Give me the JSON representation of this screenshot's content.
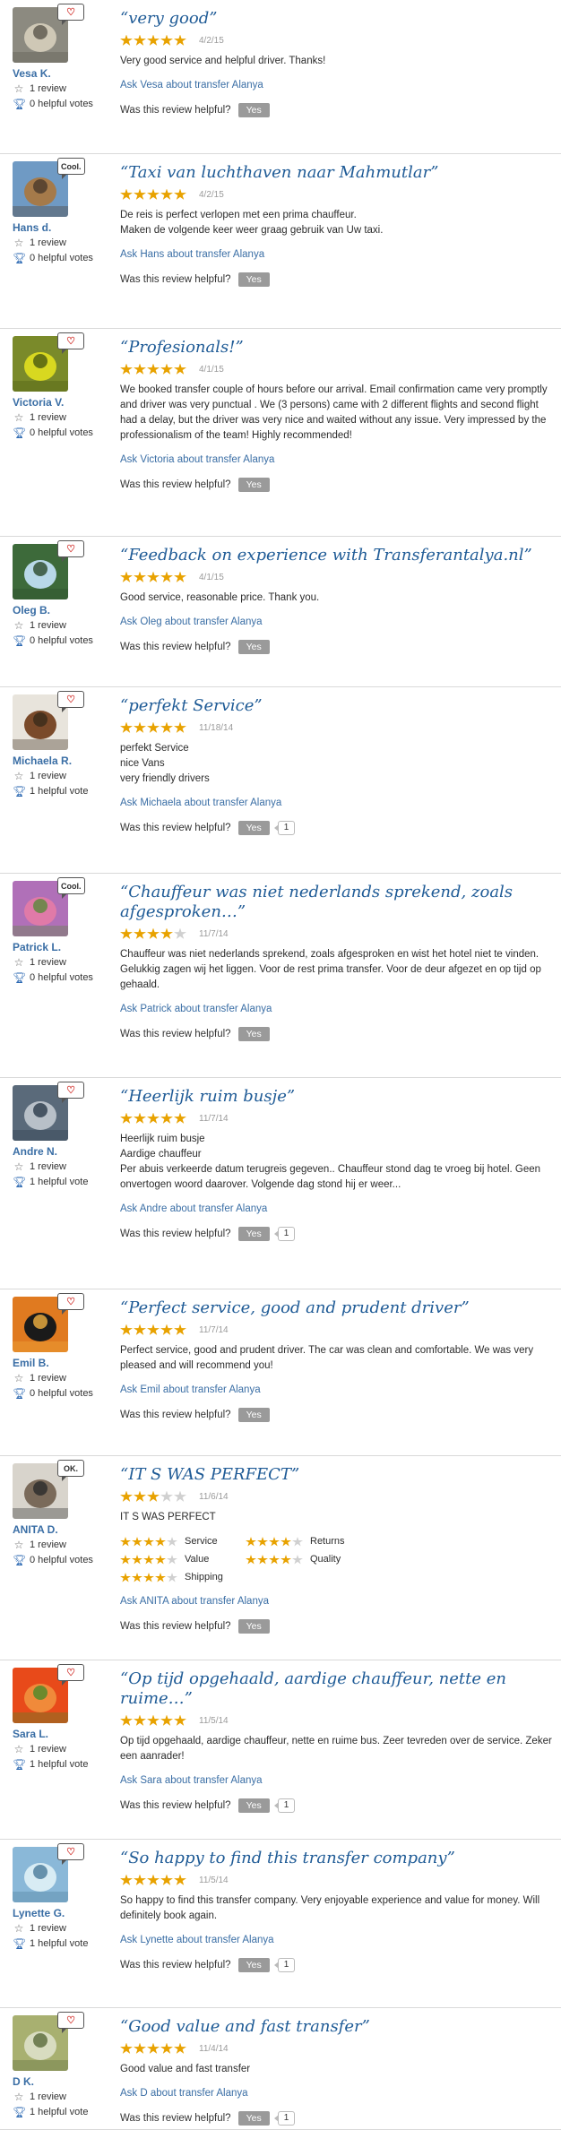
{
  "labels": {
    "review_count": "1 review",
    "helpful_question": "Was this review helpful?",
    "yes": "Yes"
  },
  "colors": {
    "link": "#3a6ea5",
    "title": "#1f5b96",
    "star_on": "#e8a200",
    "star_off": "#d0d0d0",
    "yes_button": "#9a9a9a"
  },
  "reviews": [
    {
      "member": "Vesa K.",
      "badge_type": "heart",
      "badge_text": "",
      "helpful_votes": "0 helpful votes",
      "title": "“very good”",
      "rating": 5,
      "date": "4/2/15",
      "text": [
        "Very good service and helpful driver. Thanks!"
      ],
      "ask": "Ask Vesa about transfer Alanya",
      "vote_count": "",
      "subratings": []
    },
    {
      "member": "Hans d.",
      "badge_type": "text",
      "badge_text": "Cool.",
      "helpful_votes": "0 helpful votes",
      "title": "“Taxi van luchthaven naar Mahmutlar”",
      "rating": 5,
      "date": "4/2/15",
      "text": [
        "De reis is perfect verlopen met een prima chauffeur.",
        "Maken de volgende keer weer graag gebruik van Uw taxi."
      ],
      "ask": "Ask Hans about transfer Alanya",
      "vote_count": "",
      "subratings": []
    },
    {
      "member": "Victoria V.",
      "badge_type": "heart",
      "badge_text": "",
      "helpful_votes": "0 helpful votes",
      "title": "“Profesionals!”",
      "rating": 5,
      "date": "4/1/15",
      "text": [
        "We booked transfer couple of hours before our arrival. Email confirmation came very promptly and driver was very punctual . We (3 persons) came with 2 different flights and second flight had a delay, but the driver was very nice and waited without any issue. Very impressed by the professionalism of the team! Highly recommended!"
      ],
      "ask": "Ask Victoria about transfer Alanya",
      "vote_count": "",
      "subratings": []
    },
    {
      "member": "Oleg B.",
      "badge_type": "heart",
      "badge_text": "",
      "helpful_votes": "0 helpful votes",
      "title": "“Feedback on experience with Transferantalya.nl”",
      "rating": 5,
      "date": "4/1/15",
      "text": [
        "Good service, reasonable price. Thank you."
      ],
      "ask": "Ask Oleg about transfer Alanya",
      "vote_count": "",
      "subratings": []
    },
    {
      "member": "Michaela R.",
      "badge_type": "heart",
      "badge_text": "",
      "helpful_votes": "1 helpful vote",
      "title": "“perfekt Service”",
      "rating": 5,
      "date": "11/18/14",
      "text": [
        "perfekt Service",
        "nice Vans",
        "very friendly drivers"
      ],
      "ask": "Ask Michaela about transfer Alanya",
      "vote_count": "1",
      "subratings": []
    },
    {
      "member": "Patrick L.",
      "badge_type": "text",
      "badge_text": "Cool.",
      "helpful_votes": "0 helpful votes",
      "title": "“Chauffeur was niet nederlands sprekend, zoals afgesproken…”",
      "rating": 4,
      "date": "11/7/14",
      "text": [
        "Chauffeur was niet nederlands sprekend, zoals afgesproken en wist het hotel niet te vinden. Gelukkig zagen wij het liggen. Voor de rest prima transfer. Voor de deur afgezet en op tijd op gehaald."
      ],
      "ask": "Ask Patrick about transfer Alanya",
      "vote_count": "",
      "subratings": []
    },
    {
      "member": "Andre N.",
      "badge_type": "heart",
      "badge_text": "",
      "helpful_votes": "1 helpful vote",
      "title": "“Heerlijk ruim busje”",
      "rating": 5,
      "date": "11/7/14",
      "text": [
        "Heerlijk ruim busje",
        "Aardige chauffeur",
        "Per abuis verkeerde datum terugreis gegeven.. Chauffeur stond dag te vroeg bij hotel. Geen onvertogen woord daarover. Volgende dag stond hij er weer..."
      ],
      "ask": "Ask Andre about transfer Alanya",
      "vote_count": "1",
      "subratings": []
    },
    {
      "member": "Emil B.",
      "badge_type": "heart",
      "badge_text": "",
      "helpful_votes": "0 helpful votes",
      "title": "“Perfect service, good and prudent driver”",
      "rating": 5,
      "date": "11/7/14",
      "text": [
        "Perfect service, good and prudent driver. The car was clean and comfortable. We was very pleased and will recommend you!"
      ],
      "ask": "Ask Emil about transfer Alanya",
      "vote_count": "",
      "subratings": []
    },
    {
      "member": "ANITA D.",
      "badge_type": "text",
      "badge_text": "OK.",
      "helpful_votes": "0 helpful votes",
      "title": "“IT S WAS PERFECT”",
      "rating": 3,
      "date": "11/6/14",
      "text": [
        "IT S WAS PERFECT"
      ],
      "ask": "Ask ANITA about transfer Alanya",
      "vote_count": "",
      "subratings": [
        {
          "label": "Service",
          "rating": 4
        },
        {
          "label": "Returns",
          "rating": 4
        },
        {
          "label": "Value",
          "rating": 4
        },
        {
          "label": "Quality",
          "rating": 4
        },
        {
          "label": "Shipping",
          "rating": 4
        }
      ]
    },
    {
      "member": "Sara L.",
      "badge_type": "heart",
      "badge_text": "",
      "helpful_votes": "1 helpful vote",
      "title": "“Op tijd opgehaald, aardige chauffeur, nette en ruime…”",
      "rating": 5,
      "date": "11/5/14",
      "text": [
        "Op tijd opgehaald, aardige chauffeur, nette en ruime bus. Zeer tevreden over de service. Zeker een aanrader!"
      ],
      "ask": "Ask Sara about transfer Alanya",
      "vote_count": "1",
      "subratings": []
    },
    {
      "member": "Lynette G.",
      "badge_type": "heart",
      "badge_text": "",
      "helpful_votes": "1 helpful vote",
      "title": "“So happy to find this transfer company”",
      "rating": 5,
      "date": "11/5/14",
      "text": [
        "So happy to find this transfer company. Very enjoyable experience and value for money. Will definitely book again."
      ],
      "ask": "Ask Lynette about transfer Alanya",
      "vote_count": "1",
      "subratings": []
    },
    {
      "member": "D K.",
      "badge_type": "heart",
      "badge_text": "",
      "helpful_votes": "1 helpful vote",
      "title": "“Good value and fast transfer”",
      "rating": 5,
      "date": "11/4/14",
      "text": [
        "Good value and fast transfer"
      ],
      "ask": "Ask D about transfer Alanya",
      "vote_count": "1",
      "subratings": []
    }
  ]
}
